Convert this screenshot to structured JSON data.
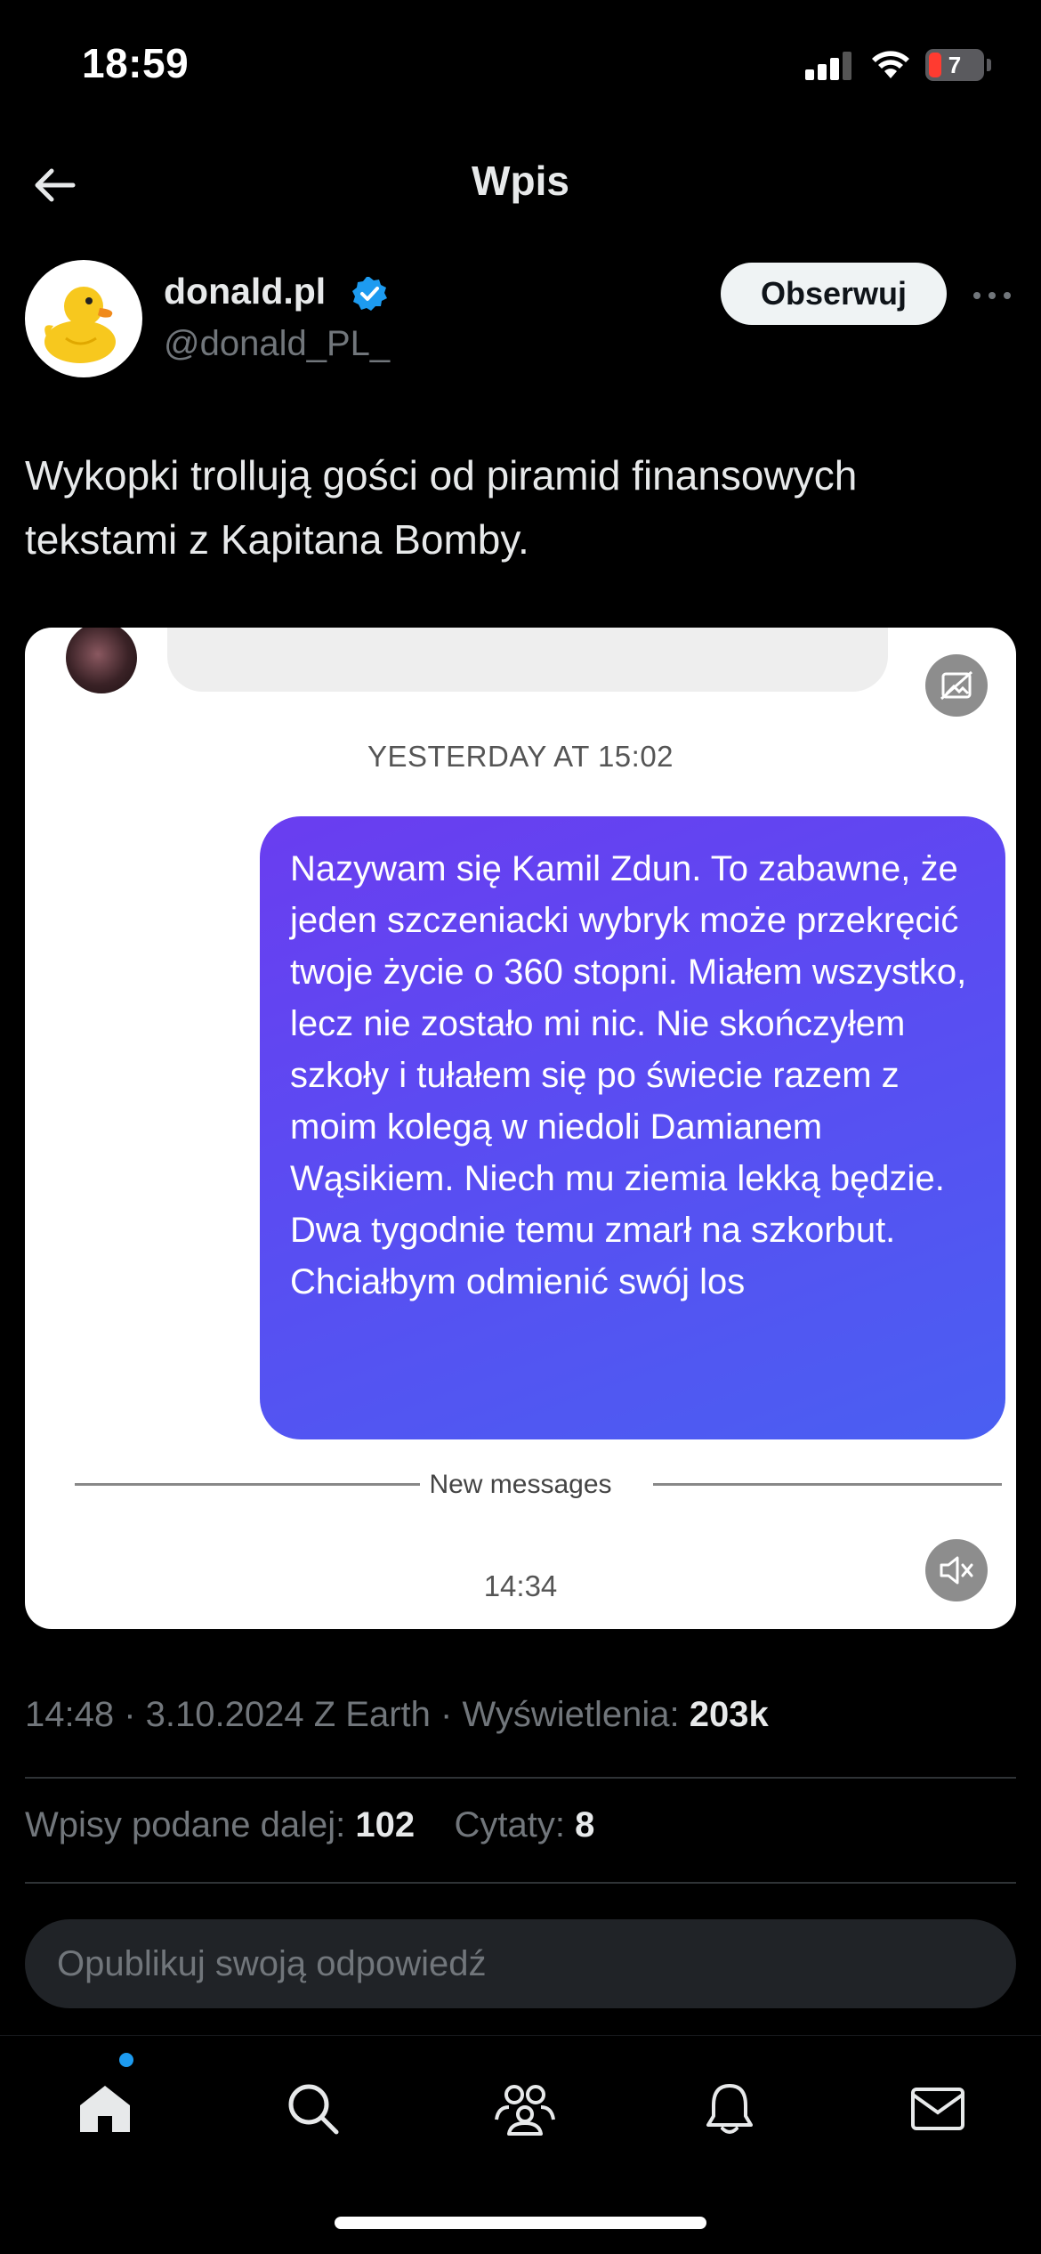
{
  "status_bar": {
    "time": "18:59",
    "battery_level": "7",
    "icons": [
      "signal-icon",
      "wifi-icon",
      "battery-icon"
    ]
  },
  "header": {
    "title": "Wpis",
    "back_icon": "arrow-left-icon"
  },
  "author": {
    "name": "donald.pl",
    "handle": "@donald_PL_",
    "verified": true,
    "follow_label": "Obserwuj",
    "avatar_icon": "rubber-duck-icon"
  },
  "post": {
    "text": "Wykopki trollują gości od piramid finansowych tekstami z Kapitana Bomby."
  },
  "media": {
    "yesterday_label": "YESTERDAY AT 15:02",
    "message_text": "Nazywam się Kamil Zdun. To zabawne, że jeden szczeniacki wybryk może przekręcić twoje życie o 360 stopni. Miałem wszystko, lecz nie zostało mi nic. Nie skończyłem szkoły i tułałem się po świecie razem z moim kolegą w niedoli Damianem Wąsikiem. Niech mu ziemia lekką będzie. Dwa tygodnie temu zmarł na szkorbut. Chciałbym odmienić swój los",
    "new_messages_label": "New messages",
    "time_label": "14:34",
    "accent_color": "#5a4cf2"
  },
  "meta": {
    "time": "14:48",
    "date": "3.10.2024",
    "source": "Z Earth",
    "views_label": "Wyświetlenia:",
    "views_count": "203k"
  },
  "stats": {
    "reposts_label": "Wpisy podane dalej:",
    "reposts_count": "102",
    "quotes_label": "Cytaty:",
    "quotes_count": "8"
  },
  "reply": {
    "placeholder": "Opublikuj swoją odpowiedź"
  },
  "tab_bar": {
    "tabs": [
      "home-icon",
      "search-icon",
      "communities-icon",
      "notifications-icon",
      "messages-icon"
    ],
    "accent": "#1d9bf0"
  }
}
